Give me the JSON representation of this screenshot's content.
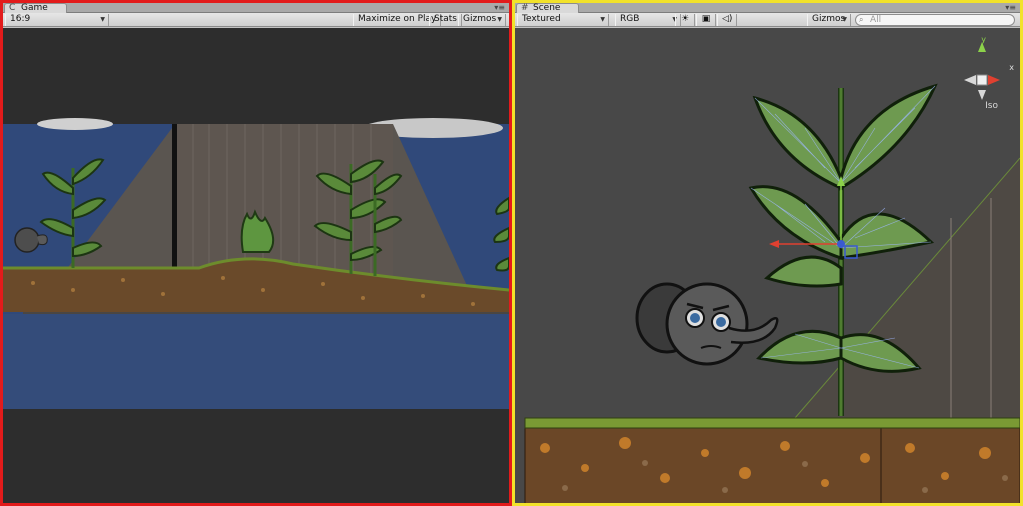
{
  "game": {
    "tab_title": "Game",
    "aspect": "16:9",
    "maximize_label": "Maximize on Play",
    "stats_label": "Stats",
    "gizmos_label": "Gizmos"
  },
  "scene": {
    "tab_title": "Scene",
    "render_mode": "Textured",
    "color_mode": "RGB",
    "gizmos_label": "Gizmos",
    "search_placeholder": "All",
    "axis_x": "x",
    "axis_y": "y",
    "projection": "Iso"
  },
  "colors": {
    "game_border": "#e21b1b",
    "scene_border": "#f2e22a"
  }
}
